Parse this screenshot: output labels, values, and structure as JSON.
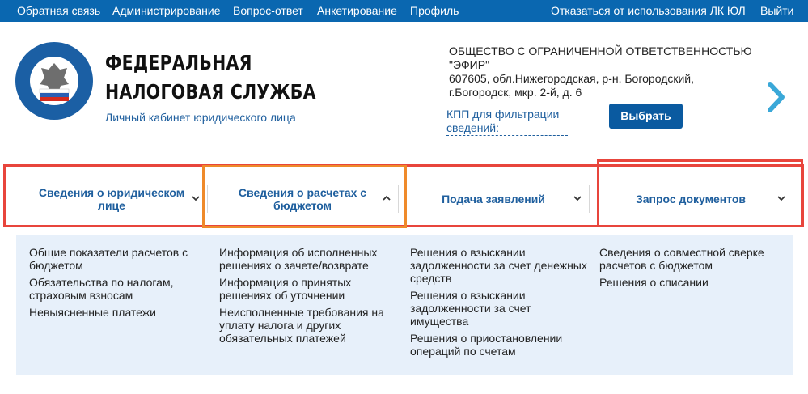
{
  "topbar": {
    "left_links": [
      "Обратная связь",
      "Администрирование",
      "Вопрос-ответ",
      "Анкетирование",
      "Профиль"
    ],
    "right_links": [
      "Отказаться от использования ЛК ЮЛ",
      "Выйти"
    ]
  },
  "header": {
    "title_line1": "ФЕДЕРАЛЬНАЯ",
    "title_line2": "НАЛОГОВАЯ СЛУЖБА",
    "subtitle": "Личный кабинет юридического лица",
    "company_lines": [
      "ОБЩЕСТВО С ОГРАНИЧЕННОЙ ОТВЕТСТВЕННОСТЬЮ",
      "\"ЭФИР\"",
      "607605, обл.Нижегородская, р-н. Богородский,",
      "г.Богородск, мкр. 2-й, д. 6"
    ],
    "kpp_link": "КПП для фильтрации сведений:",
    "select_button": "Выбрать"
  },
  "nav": {
    "tabs": [
      {
        "label": "Сведения о юридическом лице",
        "chevron": "down"
      },
      {
        "label": "Сведения о расчетах с бюджетом",
        "chevron": "up"
      },
      {
        "label": "Подача заявлений",
        "chevron": "down"
      },
      {
        "label": "Запрос документов",
        "chevron": "down"
      }
    ]
  },
  "panel": {
    "columns": [
      [
        "Общие показатели расчетов с бюджетом",
        "Обязательства по налогам, страховым взносам",
        "Невыясненные платежи"
      ],
      [
        "Информация об исполненных решениях о зачете/возврате",
        "Информация о принятых решениях об уточнении",
        "Неисполненные требования на уплату налога и других обязательных платежей"
      ],
      [
        "Решения о взыскании задолженности за счет денежных средств",
        "Решения о взыскании задолженности за счет имущества",
        "Решения о приостановлении операций по счетам"
      ],
      [
        "Сведения о совместной сверке расчетов с бюджетом",
        "Решения о списании"
      ]
    ]
  },
  "colors": {
    "topbar": "#0a67b0",
    "link": "#1f5f9e",
    "button": "#0a5aa0",
    "panel_bg": "#e7f0fa",
    "highlight_red": "#e8453c",
    "highlight_orange": "#ef8a2a"
  }
}
